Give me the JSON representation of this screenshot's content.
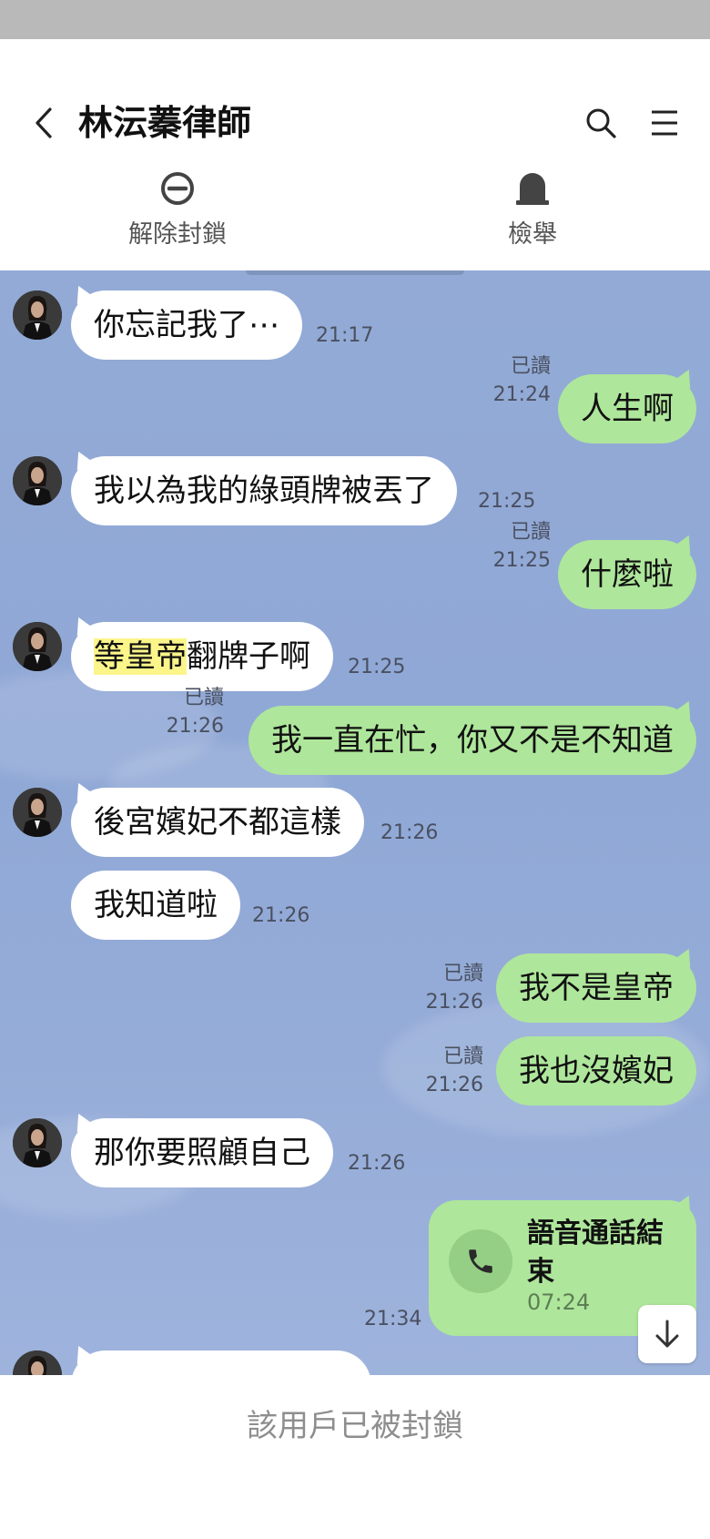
{
  "header": {
    "title": "林沄蓁律師",
    "back_icon": "chevron-left-icon",
    "search_icon": "search-icon",
    "menu_icon": "hamburger-menu-icon"
  },
  "actions": {
    "unblock_label": "解除封鎖",
    "report_label": "檢舉"
  },
  "messages": [
    {
      "side": "in",
      "text": "你忘記我了⋯",
      "time": "21:17"
    },
    {
      "side": "out",
      "text": "人生啊",
      "read": "已讀",
      "time": "21:24"
    },
    {
      "side": "in",
      "text": "我以為我的綠頭牌被丟了",
      "time": "21:25"
    },
    {
      "side": "out",
      "text": "什麼啦",
      "read": "已讀",
      "time": "21:25"
    },
    {
      "side": "in",
      "text_highlight": "等皇帝",
      "text_rest": "翻牌子啊",
      "time": "21:25"
    },
    {
      "side": "out",
      "text": "我一直在忙，你又不是不知道",
      "read": "已讀",
      "time": "21:26"
    },
    {
      "side": "in",
      "text": "後宮嬪妃不都這樣",
      "time": "21:26"
    },
    {
      "side": "in",
      "text": "我知道啦",
      "time": "21:26"
    },
    {
      "side": "out",
      "text": "我不是皇帝",
      "read": "已讀",
      "time": "21:26"
    },
    {
      "side": "out",
      "text": "我也沒嬪妃",
      "read": "已讀",
      "time": "21:26"
    },
    {
      "side": "in",
      "text": "那你要照顧自己",
      "time": "21:26"
    }
  ],
  "call": {
    "title": "語音通話結束",
    "duration": "07:24",
    "time": "21:34"
  },
  "footer": {
    "blocked_text": "該用戶已被封鎖"
  },
  "colors": {
    "chat_bg": "#93aad6",
    "outgoing_bubble": "#aee69b",
    "incoming_bubble": "#ffffff",
    "highlight": "#fbf58a"
  }
}
